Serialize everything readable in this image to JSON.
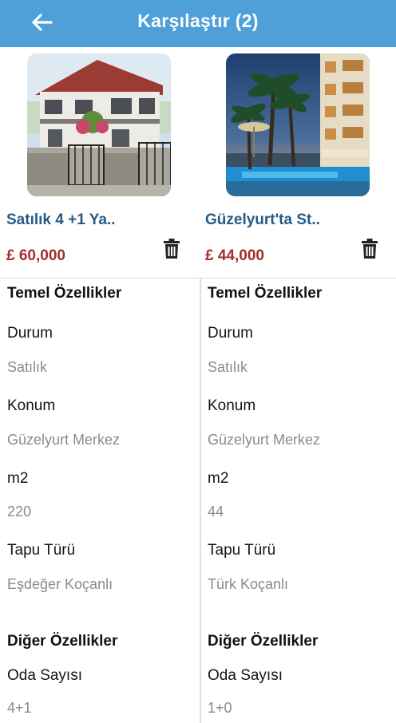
{
  "header": {
    "title": "Karşılaştır (2)"
  },
  "items": [
    {
      "title": "Satılık 4 +1 Ya..",
      "price": "£ 60,000",
      "basic_title": "Temel Özellikler",
      "basic": [
        {
          "label": "Durum",
          "value": "Satılık"
        },
        {
          "label": "Konum",
          "value": "Güzelyurt Merkez"
        },
        {
          "label": "m2",
          "value": "220"
        },
        {
          "label": "Tapu Türü",
          "value": "Eşdeğer Koçanlı"
        }
      ],
      "other_title": "Diğer Özellikler",
      "other": [
        {
          "label": "Oda Sayısı",
          "value": "4+1"
        }
      ]
    },
    {
      "title": "Güzelyurt'ta St..",
      "price": "£ 44,000",
      "basic_title": "Temel Özellikler",
      "basic": [
        {
          "label": "Durum",
          "value": "Satılık"
        },
        {
          "label": "Konum",
          "value": "Güzelyurt Merkez"
        },
        {
          "label": "m2",
          "value": "44"
        },
        {
          "label": "Tapu Türü",
          "value": "Türk Koçanlı"
        }
      ],
      "other_title": "Diğer Özellikler",
      "other": [
        {
          "label": "Oda Sayısı",
          "value": "1+0"
        }
      ]
    }
  ],
  "colors": {
    "appbar": "#4f9fd9",
    "title_link": "#245b86",
    "price": "#a32e2e",
    "value_text": "#8a8a8a"
  },
  "icons": [
    "arrow-left-icon",
    "trash-icon"
  ]
}
